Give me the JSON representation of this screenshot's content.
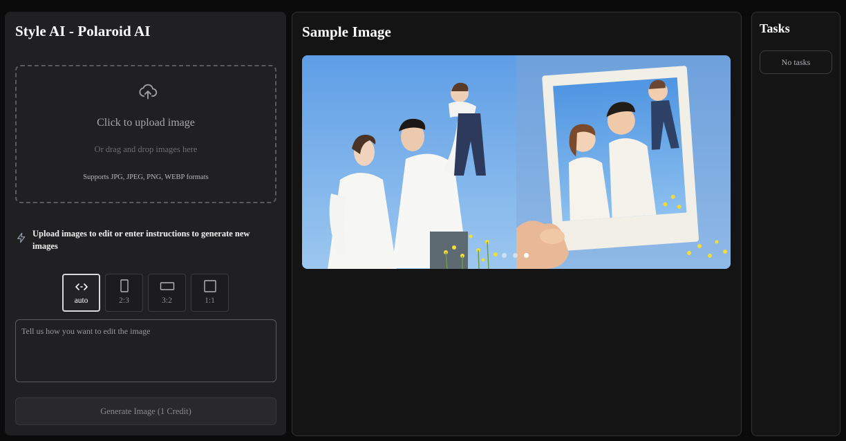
{
  "left_panel": {
    "title": "Style AI - Polaroid AI",
    "upload": {
      "icon": "cloud-upload-icon",
      "title": "Click to upload image",
      "subtitle": "Or drag and drop images here",
      "formats": "Supports JPG, JPEG, PNG, WEBP formats"
    },
    "hint": {
      "icon": "lightning-icon",
      "text": "Upload images to edit or enter instructions to generate new images"
    },
    "ratios": [
      {
        "label": "auto",
        "icon": "code-arrows-icon",
        "selected": true
      },
      {
        "label": "2:3",
        "icon": "portrait-rect-icon",
        "selected": false
      },
      {
        "label": "3:2",
        "icon": "landscape-rect-icon",
        "selected": false
      },
      {
        "label": "1:1",
        "icon": "square-icon",
        "selected": false
      }
    ],
    "prompt": {
      "placeholder": "Tell us how you want to edit the image",
      "value": ""
    },
    "generate_button": "Generate Image (1 Credit)"
  },
  "middle_panel": {
    "title": "Sample Image",
    "carousel": {
      "slide_count": 3,
      "active_slide": 3
    }
  },
  "right_panel": {
    "title": "Tasks",
    "empty_text": "No tasks"
  },
  "colors": {
    "background": "#0b0b0c",
    "panel_left": "#202022",
    "panel_dark": "#141414",
    "sky": "#6aa0e0"
  }
}
